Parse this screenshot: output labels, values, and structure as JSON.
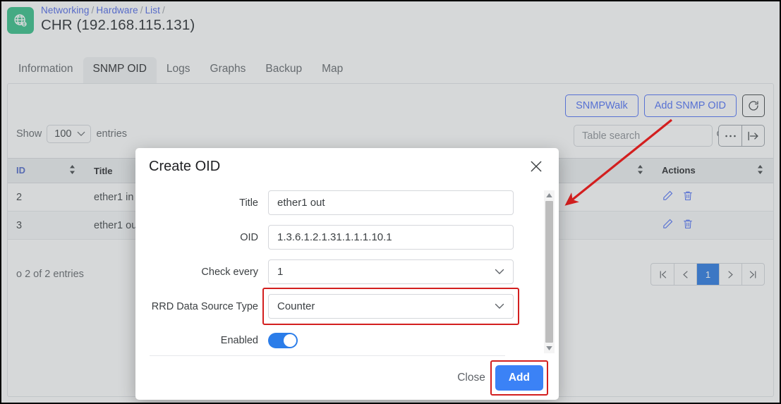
{
  "header": {
    "app_icon": "globe-network-icon",
    "breadcrumb": [
      "Networking",
      "Hardware",
      "List"
    ],
    "separator": "/",
    "title": "CHR (192.168.115.131)",
    "accent_green": "#2ebd85",
    "link_blue": "#4a63e7"
  },
  "tabs": [
    {
      "label": "Information",
      "active": false
    },
    {
      "label": "SNMP OID",
      "active": true
    },
    {
      "label": "Logs",
      "active": false
    },
    {
      "label": "Graphs",
      "active": false
    },
    {
      "label": "Backup",
      "active": false
    },
    {
      "label": "Map",
      "active": false
    }
  ],
  "toolbar": {
    "snmpwalk_label": "SNMPWalk",
    "add_snmp_oid_label": "Add SNMP OID",
    "refresh_icon": "refresh-icon",
    "more_icon": "ellipsis-icon",
    "export_icon": "export-arrow-icon"
  },
  "search": {
    "placeholder": "Table search",
    "value": "",
    "icon": "search-icon"
  },
  "show_entries": {
    "prefix": "Show",
    "value": "100",
    "suffix": "entries"
  },
  "table": {
    "columns": [
      "ID",
      "Title",
      "",
      "Actions"
    ],
    "rows": [
      {
        "id": "2",
        "title": "ether1 in",
        "edit_icon": "pencil-icon",
        "delete_icon": "trash-icon"
      },
      {
        "id": "3",
        "title": "ether1 out",
        "edit_icon": "pencil-icon",
        "delete_icon": "trash-icon"
      }
    ],
    "entries_info": "o 2 of 2 entries",
    "pager": {
      "first": "|<",
      "prev": "<",
      "current": "1",
      "next": ">",
      "last": ">|"
    }
  },
  "modal": {
    "title": "Create OID",
    "close_icon": "close-icon",
    "fields": [
      {
        "label": "Title",
        "type": "text",
        "value": "ether1 out"
      },
      {
        "label": "OID",
        "type": "text",
        "value": "1.3.6.1.2.1.31.1.1.1.10.1"
      },
      {
        "label": "Check every",
        "type": "select",
        "value": "1"
      },
      {
        "label": "RRD Data Source Type",
        "type": "select",
        "value": "Counter",
        "highlighted": true
      },
      {
        "label": "Enabled",
        "type": "toggle",
        "value": "on"
      }
    ],
    "close_label": "Close",
    "add_label": "Add",
    "add_highlighted": true,
    "highlight_color": "#d31f1f",
    "add_button_color": "#3b82f6"
  },
  "annotation": {
    "arrow_color": "#d31f1f",
    "description": "red arrow pointing from Add SNMP OID button down-left toward table area"
  }
}
